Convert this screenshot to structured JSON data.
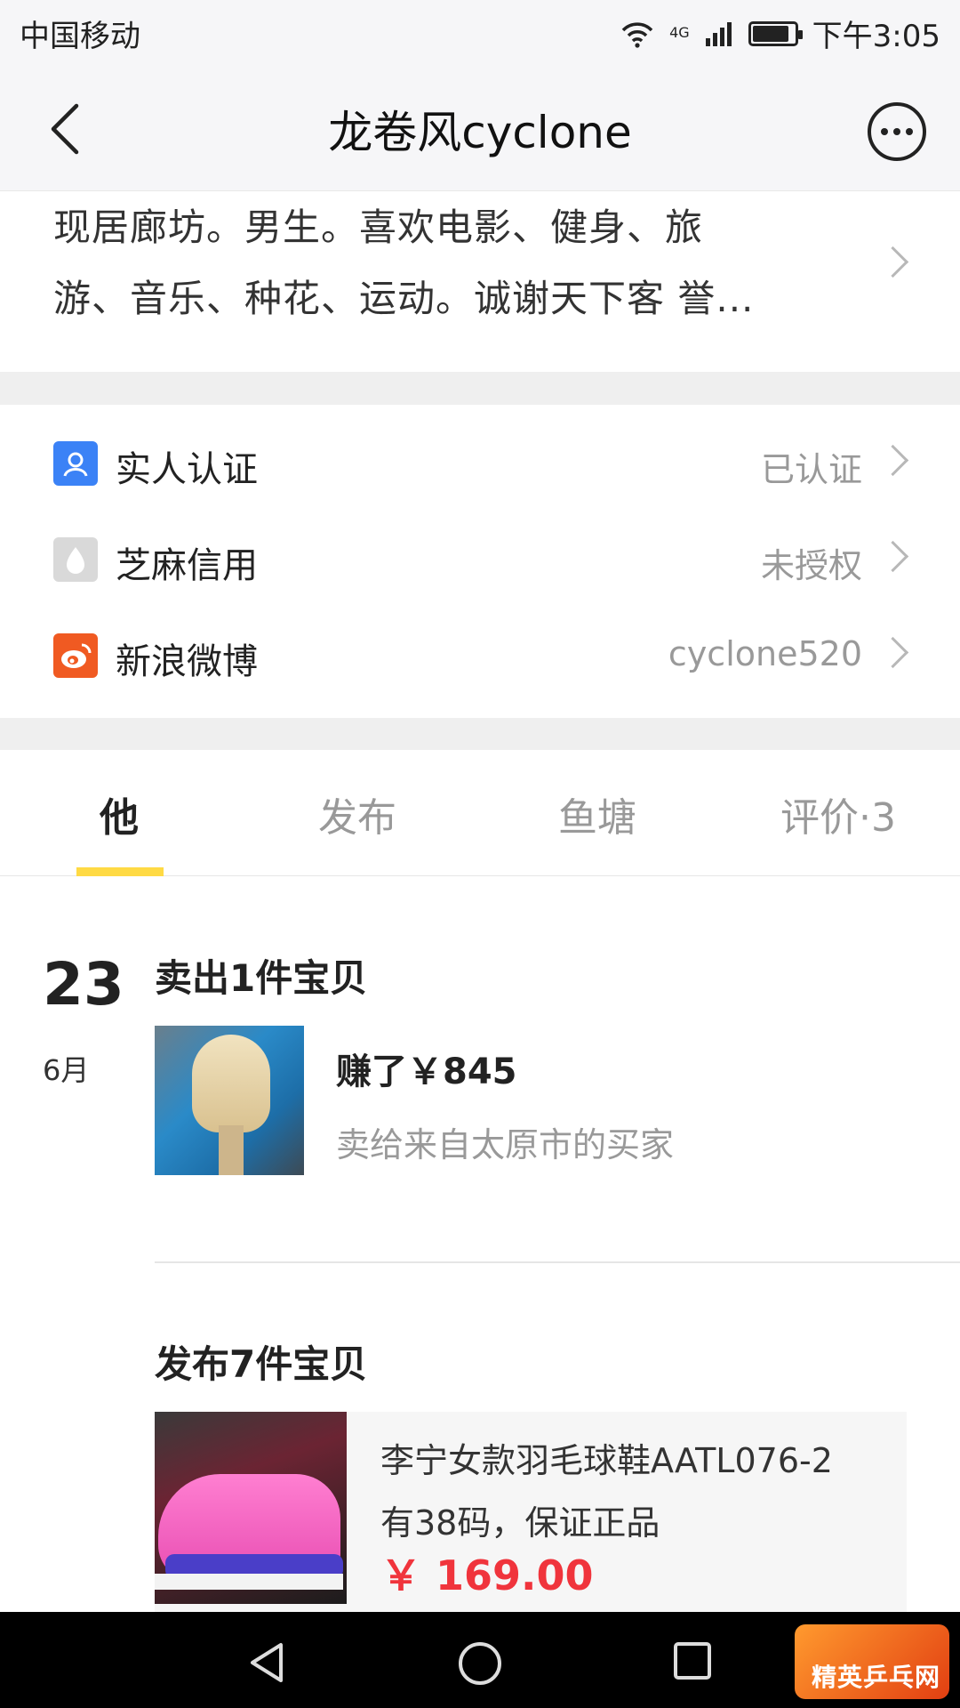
{
  "status_bar": {
    "carrier": "中国移动",
    "network": "4G",
    "time": "下午3:05"
  },
  "nav": {
    "title": "龙卷风cyclone"
  },
  "bio": {
    "line1": "现居廊坊。男生。喜欢电影、健身、旅",
    "line2": "游、音乐、种花、运动。诚谢天下客 誉..."
  },
  "verifications": [
    {
      "label": "实人认证",
      "value": "已认证",
      "icon": "person-badge-icon",
      "color": "#3b82f6"
    },
    {
      "label": "芝麻信用",
      "value": "未授权",
      "icon": "sesame-credit-icon",
      "color": "#d6d6d6"
    },
    {
      "label": "新浪微博",
      "value": "cyclone520",
      "icon": "weibo-icon",
      "color": "#f05a22"
    }
  ],
  "tabs": [
    {
      "label": "他",
      "active": true
    },
    {
      "label": "发布",
      "active": false
    },
    {
      "label": "鱼塘",
      "active": false
    },
    {
      "label": "评价·3",
      "active": false
    }
  ],
  "feed": {
    "day": "23",
    "month": "6月",
    "sold_title": "卖出1件宝贝",
    "earned": "赚了￥845",
    "buyer": "卖给来自太原市的买家",
    "published_title": "发布7件宝贝",
    "item": {
      "title_line1": "李宁女款羽毛球鞋AATL076-2",
      "title_line2": "有38码，保证正品",
      "price": "￥ 169.00"
    }
  },
  "watermark": {
    "text": "精英乒乓网"
  },
  "colors": {
    "accent_yellow": "#ffda44",
    "price_red": "#f0343c",
    "background_gray": "#efefef"
  }
}
